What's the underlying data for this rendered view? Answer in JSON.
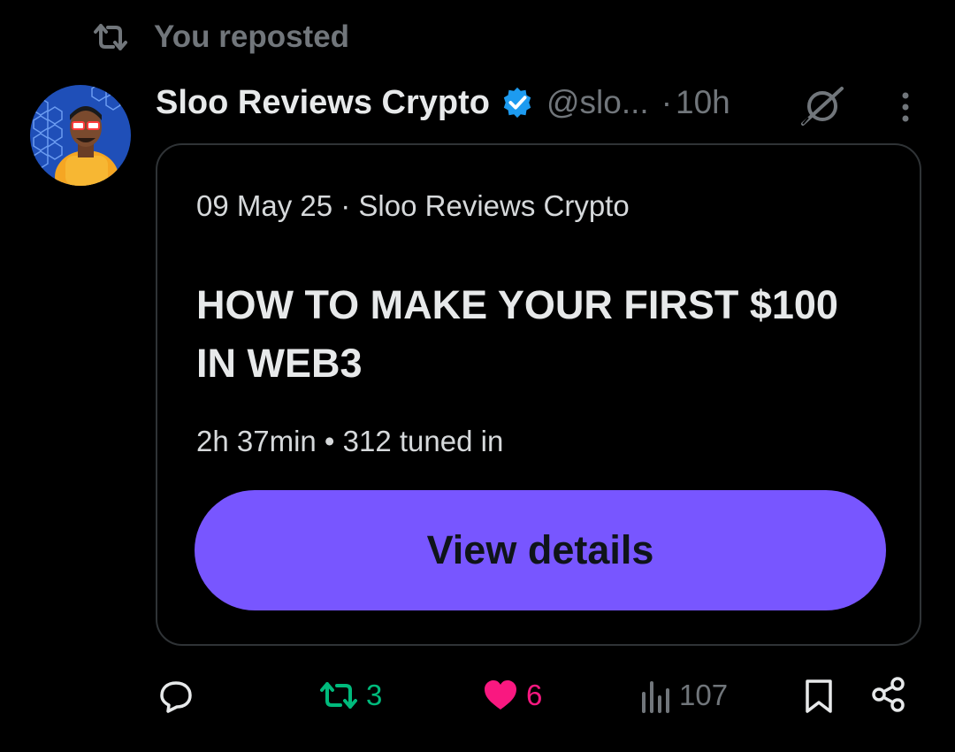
{
  "repost_context": {
    "label": "You reposted",
    "icon": "repost-icon"
  },
  "post": {
    "author": {
      "display_name": "Sloo Reviews Crypto",
      "handle": "@slo...",
      "verified": true,
      "avatar": "avatar-image"
    },
    "separator": "·",
    "time": "10h",
    "card": {
      "meta": "09 May 25 · Sloo Reviews Crypto",
      "title": "HOW TO MAKE YOUR FIRST $100 IN WEB3",
      "stats": "2h 37min • 312 tuned in",
      "button_label": "View details"
    },
    "actions": {
      "reply": {
        "icon": "reply-icon",
        "count": ""
      },
      "repost": {
        "icon": "repost-icon",
        "count": "3",
        "active": true
      },
      "like": {
        "icon": "heart-icon",
        "count": "6",
        "active": true
      },
      "views": {
        "icon": "views-icon",
        "count": "107"
      },
      "bookmark": {
        "icon": "bookmark-icon"
      },
      "share": {
        "icon": "share-icon"
      }
    }
  },
  "colors": {
    "background": "#000000",
    "text_primary": "#e7e9ea",
    "text_secondary": "#71767b",
    "accent_button": "#7856ff",
    "repost_green": "#00ba7c",
    "like_pink": "#f91880",
    "verified_blue": "#1d9bf0",
    "card_border": "#2f3336"
  }
}
